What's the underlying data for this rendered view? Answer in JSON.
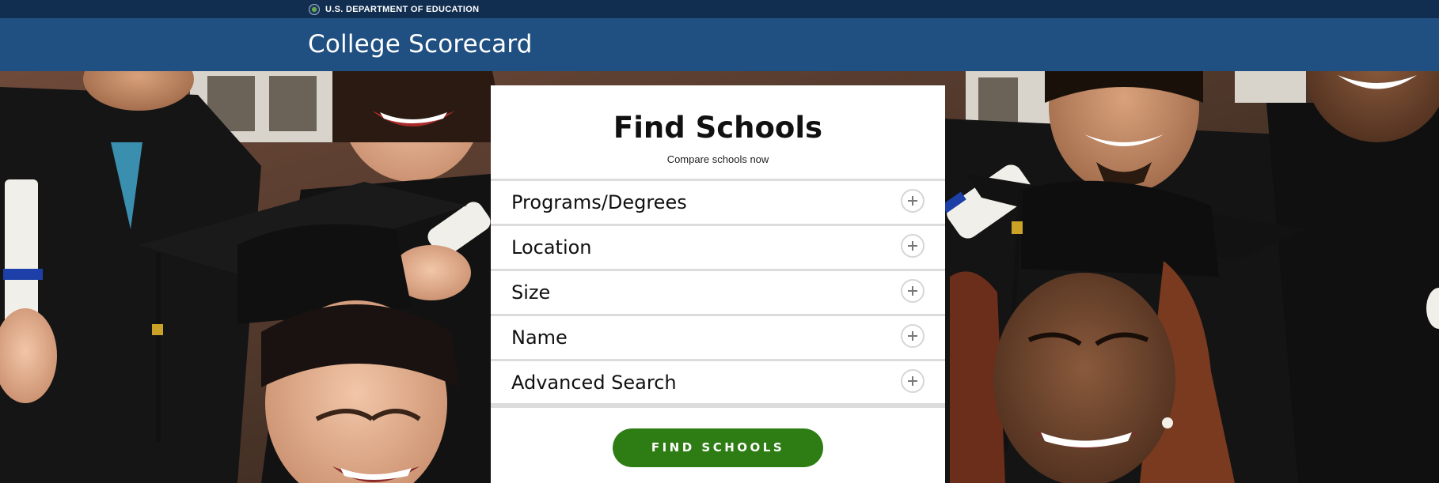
{
  "gov_banner": {
    "agency": "U.S. DEPARTMENT OF EDUCATION",
    "seal_icon": "department-seal-icon"
  },
  "header": {
    "site_title": "College Scorecard"
  },
  "hero": {
    "image": "graduates-photo"
  },
  "search": {
    "title": "Find Schools",
    "subtitle": "Compare schools now",
    "filters": [
      {
        "label": "Programs/Degrees",
        "icon": "plus-icon"
      },
      {
        "label": "Location",
        "icon": "plus-icon"
      },
      {
        "label": "Size",
        "icon": "plus-icon"
      },
      {
        "label": "Name",
        "icon": "plus-icon"
      },
      {
        "label": "Advanced Search",
        "icon": "plus-icon"
      }
    ],
    "submit_label": "FIND SCHOOLS"
  },
  "colors": {
    "gov_banner": "#112e51",
    "header": "#205081",
    "button": "#2e7d14",
    "panel": "#ffffff"
  }
}
